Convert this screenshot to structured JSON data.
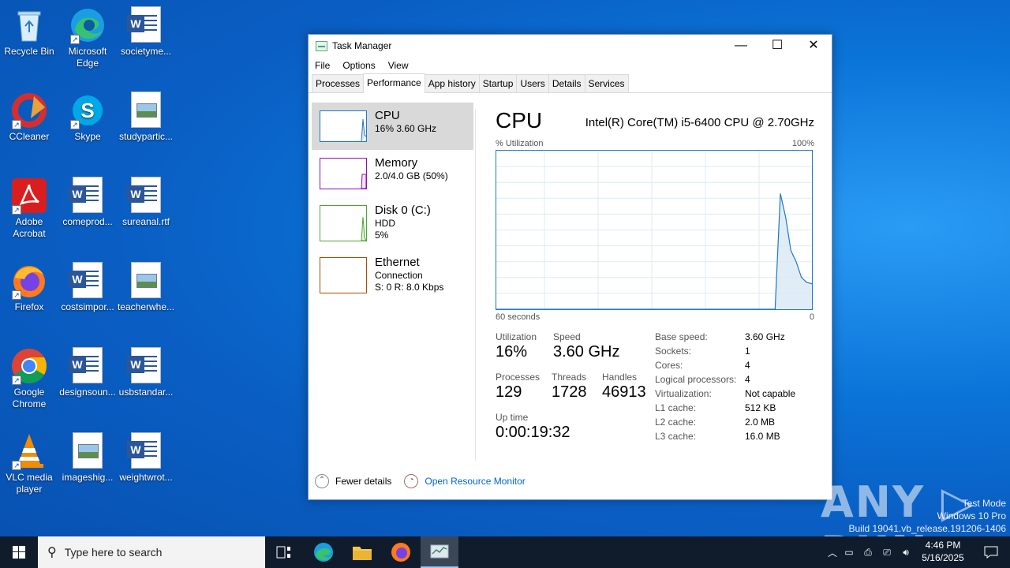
{
  "desktop": {
    "icons": [
      {
        "label": "Recycle Bin"
      },
      {
        "label": "Microsoft Edge"
      },
      {
        "label": "societyme..."
      },
      {
        "label": "CCleaner"
      },
      {
        "label": "Skype"
      },
      {
        "label": "studypartic..."
      },
      {
        "label": "Adobe Acrobat"
      },
      {
        "label": "comeprod..."
      },
      {
        "label": "sureanal.rtf"
      },
      {
        "label": "Firefox"
      },
      {
        "label": "costsimpor..."
      },
      {
        "label": "teacherwhe..."
      },
      {
        "label": "Google Chrome"
      },
      {
        "label": "designsoun..."
      },
      {
        "label": "usbstandar..."
      },
      {
        "label": "VLC media player"
      },
      {
        "label": "imageshig..."
      },
      {
        "label": "weightwrot..."
      }
    ]
  },
  "taskmanager": {
    "title": "Task Manager",
    "menu": [
      "File",
      "Options",
      "View"
    ],
    "tabs": [
      "Processes",
      "Performance",
      "App history",
      "Startup",
      "Users",
      "Details",
      "Services"
    ],
    "sidebar": [
      {
        "name": "CPU",
        "line1": "16%  3.60 GHz",
        "line2": "",
        "color": "#1f78c1"
      },
      {
        "name": "Memory",
        "line1": "2.0/4.0 GB (50%)",
        "line2": "",
        "color": "#8b12ae"
      },
      {
        "name": "Disk 0 (C:)",
        "line1": "HDD",
        "line2": "5%",
        "color": "#4da832"
      },
      {
        "name": "Ethernet",
        "line1": "Connection",
        "line2": "S: 0  R: 8.0 Kbps",
        "color": "#a74f01"
      }
    ],
    "main": {
      "heading": "CPU",
      "model": "Intel(R) Core(TM) i5-6400 CPU @ 2.70GHz",
      "y_label": "% Utilization",
      "y_max": "100%",
      "x_left": "60 seconds",
      "x_right": "0",
      "stats": {
        "utilization_label": "Utilization",
        "utilization": "16%",
        "speed_label": "Speed",
        "speed": "3.60 GHz",
        "processes_label": "Processes",
        "processes": "129",
        "threads_label": "Threads",
        "threads": "1728",
        "handles_label": "Handles",
        "handles": "46913",
        "uptime_label": "Up time",
        "uptime": "0:00:19:32"
      },
      "specs": [
        {
          "k": "Base speed:",
          "v": "3.60 GHz"
        },
        {
          "k": "Sockets:",
          "v": "1"
        },
        {
          "k": "Cores:",
          "v": "4"
        },
        {
          "k": "Logical processors:",
          "v": "4"
        },
        {
          "k": "Virtualization:",
          "v": "Not capable"
        },
        {
          "k": "L1 cache:",
          "v": "512 KB"
        },
        {
          "k": "L2 cache:",
          "v": "2.0 MB"
        },
        {
          "k": "L3 cache:",
          "v": "16.0 MB"
        }
      ]
    },
    "footer": {
      "fewer": "Fewer details",
      "monitor": "Open Resource Monitor"
    }
  },
  "chart_data": {
    "type": "area",
    "x": [
      60,
      59,
      58,
      57,
      56,
      55,
      54,
      53,
      52,
      51,
      50,
      49,
      48,
      47,
      46,
      45,
      44,
      43,
      42,
      41,
      40,
      39,
      38,
      37,
      36,
      35,
      34,
      33,
      32,
      31,
      30,
      29,
      28,
      27,
      26,
      25,
      24,
      23,
      22,
      21,
      20,
      19,
      18,
      17,
      16,
      15,
      14,
      13,
      12,
      11,
      10,
      9,
      8,
      7,
      6,
      5,
      4,
      3,
      2,
      1,
      0
    ],
    "values": [
      0,
      0,
      0,
      0,
      0,
      0,
      0,
      0,
      0,
      0,
      0,
      0,
      0,
      0,
      0,
      0,
      0,
      0,
      0,
      0,
      0,
      0,
      0,
      0,
      0,
      0,
      0,
      0,
      0,
      0,
      0,
      0,
      0,
      0,
      0,
      0,
      0,
      0,
      0,
      0,
      0,
      0,
      0,
      0,
      0,
      0,
      0,
      0,
      0,
      0,
      0,
      0,
      0,
      0,
      73,
      58,
      37,
      30,
      20,
      17,
      16
    ],
    "ylim": [
      0,
      100
    ],
    "xlim": [
      60,
      0
    ]
  },
  "taskbar": {
    "search_placeholder": "Type here to search",
    "time": "4:46 PM",
    "date": "5/16/2025"
  },
  "watermark": {
    "line1": "Test Mode",
    "line2": "Windows 10 Pro",
    "line3": "Build 19041.vb_release.191206-1406",
    "brand": "ANY RUN"
  }
}
